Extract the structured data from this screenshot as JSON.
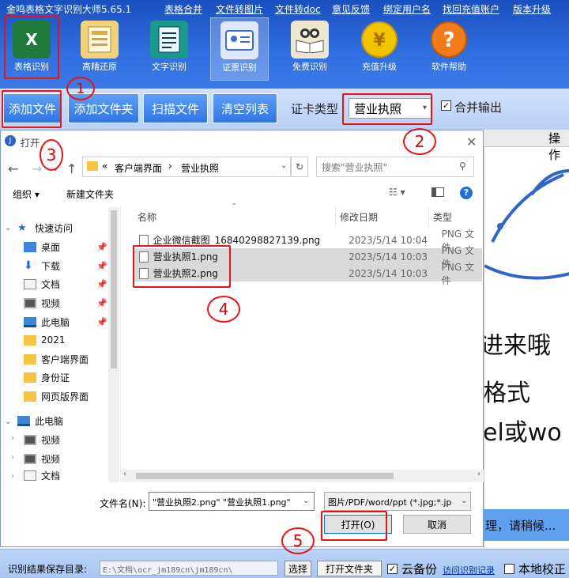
{
  "app": {
    "title": "金鸣表格文字识别大师5.65.1",
    "menu": [
      "表格合并",
      "文件转图片",
      "文件转doc",
      "意见反馈",
      "绑定用户名",
      "找回充值账户",
      "版本升级"
    ]
  },
  "tools": [
    {
      "label": "表格识别",
      "icon": "excel-icon"
    },
    {
      "label": "高精还原",
      "icon": "layout-icon"
    },
    {
      "label": "文字识别",
      "icon": "document-icon"
    },
    {
      "label": "证票识别",
      "icon": "id-card-icon"
    },
    {
      "label": "免费识别",
      "icon": "book-icon"
    },
    {
      "label": "充值升级",
      "icon": "yen-coin-icon"
    },
    {
      "label": "软件帮助",
      "icon": "help-icon"
    }
  ],
  "toolbar2": {
    "add_file": "添加文件",
    "add_folder": "添加文件夹",
    "scan_file": "扫描文件",
    "clear_list": "清空列表",
    "card_type_label": "证卡类型",
    "card_type_value": "营业执照",
    "merge_output": "合并输出"
  },
  "right_panel": {
    "header": "操作",
    "lines": [
      "进来哦",
      "格式",
      "el或wo"
    ],
    "processing": "理，请稍候..."
  },
  "dialog": {
    "title": "打开",
    "address": [
      "«",
      "客户端界面",
      "›",
      "营业执照"
    ],
    "search_placeholder": "搜索\"营业执照\"",
    "organize": "组织 ▾",
    "new_folder": "新建文件夹",
    "sidebar": [
      {
        "label": "快速访问",
        "icon": "star-icon",
        "level": 0
      },
      {
        "label": "桌面",
        "icon": "desktop-icon",
        "level": 1,
        "pinned": true
      },
      {
        "label": "下载",
        "icon": "download-icon",
        "level": 1,
        "pinned": true
      },
      {
        "label": "文档",
        "icon": "documents-icon",
        "level": 1,
        "pinned": true
      },
      {
        "label": "视频",
        "icon": "video-icon",
        "level": 1,
        "pinned": true
      },
      {
        "label": "此电脑",
        "icon": "computer-icon",
        "level": 1,
        "pinned": true
      },
      {
        "label": "2021",
        "icon": "folder-icon",
        "level": 1
      },
      {
        "label": "客户端界面",
        "icon": "folder-icon",
        "level": 1
      },
      {
        "label": "身份证",
        "icon": "folder-icon",
        "level": 1
      },
      {
        "label": "网页版界面",
        "icon": "folder-icon",
        "level": 1
      },
      {
        "label": "此电脑",
        "icon": "computer-icon",
        "level": 0
      },
      {
        "label": "视频",
        "icon": "video-icon",
        "level": 1
      },
      {
        "label": "视频",
        "icon": "video-icon",
        "level": 1
      },
      {
        "label": "文档",
        "icon": "documents-icon",
        "level": 1
      }
    ],
    "columns": [
      "名称",
      "修改日期",
      "类型"
    ],
    "files": [
      {
        "name": "企业微信截图_16840298827139.png",
        "date": "2023/5/14 10:04",
        "type": "PNG 文件",
        "selected": false
      },
      {
        "name": "营业执照1.png",
        "date": "2023/5/14 10:03",
        "type": "PNG 文件",
        "selected": true
      },
      {
        "name": "营业执照2.png",
        "date": "2023/5/14 10:03",
        "type": "PNG 文件",
        "selected": true
      }
    ],
    "filename_label": "文件名(N):",
    "filename_value": "\"营业执照2.png\" \"营业执照1.png\"",
    "filter_value": "图片/PDF/word/ppt (*.jpg;*.jp",
    "open_button": "打开(O)",
    "cancel_button": "取消"
  },
  "bottom": {
    "save_label": "识别结果保存目录:",
    "save_path": "E:\\文档\\ocr_jm189cn\\jm189cn\\",
    "choose_button": "选择",
    "open_folder_button": "打开文件夹",
    "cloud_backup": "云备份",
    "visit_records": "访问识别记录",
    "local_verify": "本地校正"
  },
  "annotations": [
    "1",
    "2",
    "3",
    "4",
    "5"
  ],
  "colors": {
    "accent_blue": "#2f76e5",
    "annotation_red": "#e11111",
    "title_band": "#1a4fbf"
  }
}
